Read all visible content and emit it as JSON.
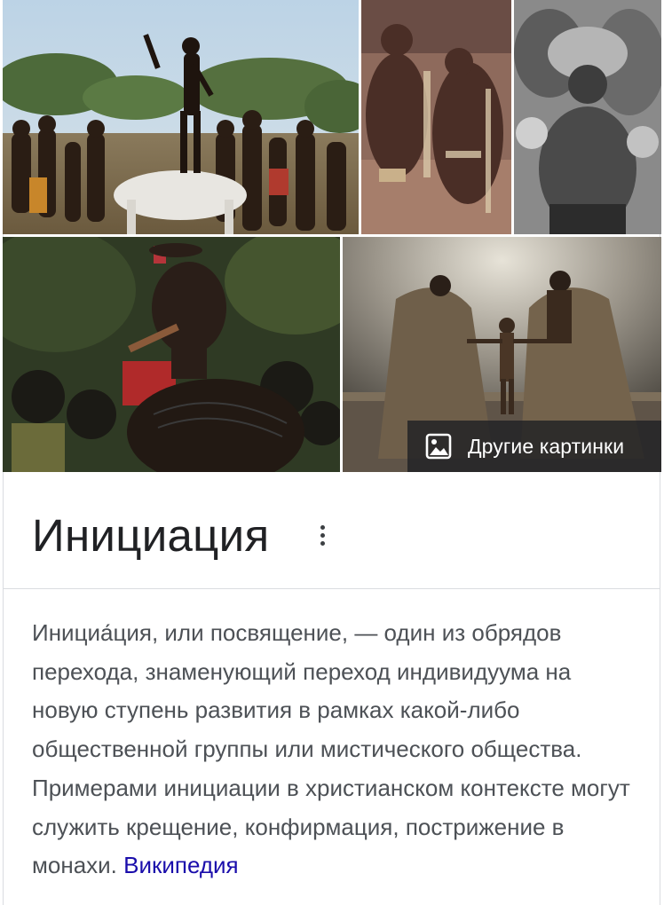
{
  "gallery": {
    "images": [
      {
        "name": "ceremony-dance-image",
        "icon": "photo"
      },
      {
        "name": "tribal-group-image",
        "icon": "photo"
      },
      {
        "name": "masked-man-image",
        "icon": "photo"
      },
      {
        "name": "initiate-portrait-image",
        "icon": "photo"
      },
      {
        "name": "cloaked-figures-image",
        "icon": "photo"
      }
    ],
    "more_images_label": "Другие картинки",
    "more_images_icon": "image-icon"
  },
  "entity": {
    "title": "Инициация",
    "menu_icon": "more-vert-icon"
  },
  "description": {
    "text": "Инициа́ция, или посвящение, — один из обрядов перехода, знаменующий переход индивидуума на новую ступень развития в рамках какой-либо общественной группы или мистического общества. Примерами инициации в христианском контексте могут служить крещение, конфирмация, пострижение в монахи. ",
    "source_link": "Википедия",
    "link_color": "#1a0dab",
    "text_color": "#4d5156"
  }
}
